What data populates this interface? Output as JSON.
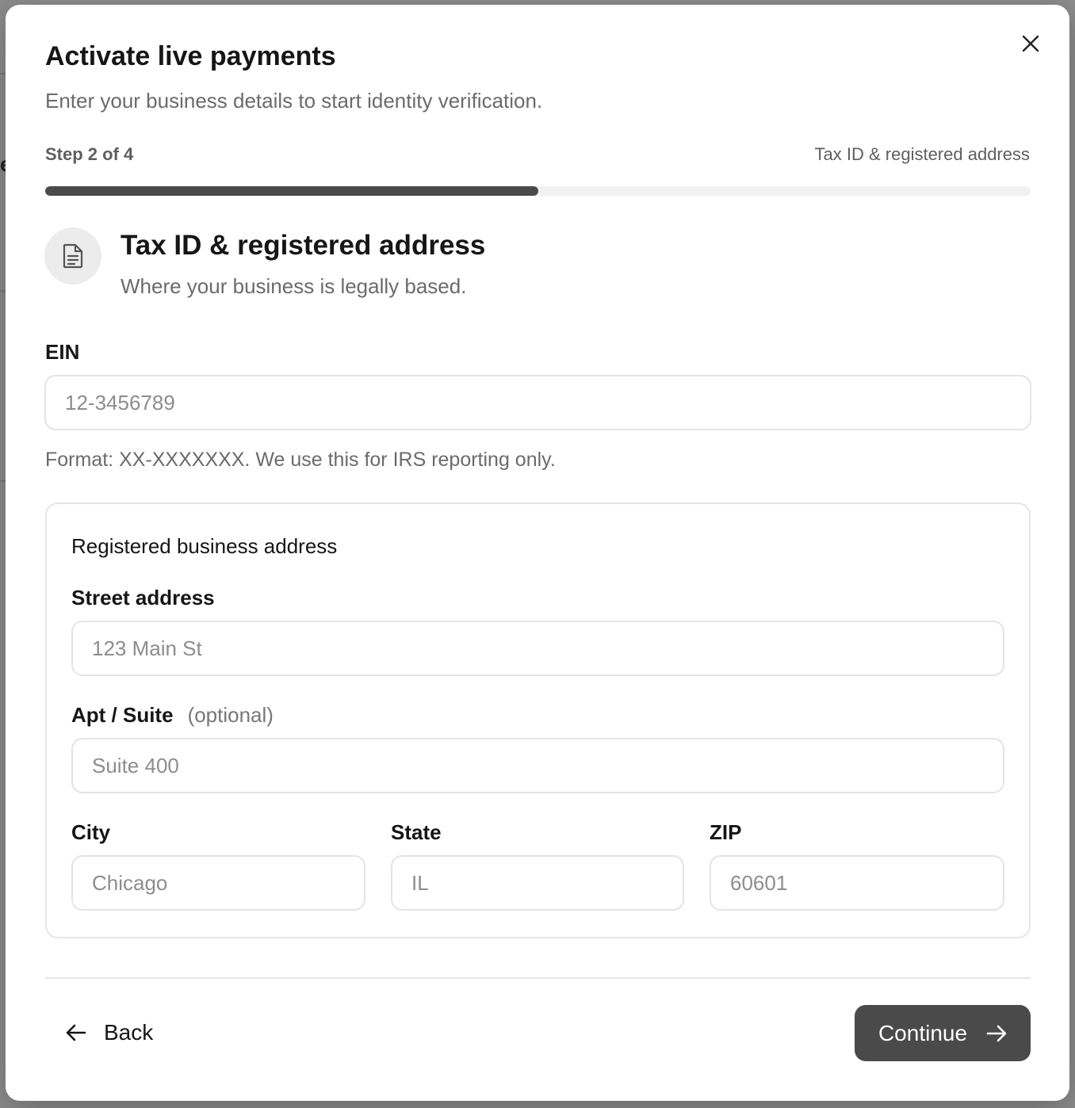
{
  "dialog": {
    "title": "Activate live payments",
    "subtitle": "Enter your business details to start identity verification."
  },
  "progress": {
    "step_label": "Step 2 of 4",
    "step_name": "Tax ID & registered address",
    "current_step": 2,
    "total_steps": 4,
    "fill_fraction": 0.5
  },
  "section": {
    "icon": "document-icon",
    "title": "Tax ID & registered address",
    "description": "Where your business is legally based."
  },
  "ein": {
    "label": "EIN",
    "placeholder": "12-3456789",
    "help": "Format: XX-XXXXXXX. We use this for IRS reporting only."
  },
  "address": {
    "card_title": "Registered business address",
    "street": {
      "label": "Street address",
      "placeholder": "123 Main St"
    },
    "apt": {
      "label": "Apt / Suite",
      "optional": "(optional)",
      "placeholder": "Suite 400"
    },
    "city": {
      "label": "City",
      "placeholder": "Chicago"
    },
    "state": {
      "label": "State",
      "placeholder": "IL"
    },
    "zip": {
      "label": "ZIP",
      "placeholder": "60601"
    }
  },
  "footer": {
    "back_label": "Back",
    "continue_label": "Continue"
  },
  "colors": {
    "progress_fill": "#4a4a4a",
    "primary_button": "#4a4a4a",
    "muted_text": "#6b6b6b"
  }
}
